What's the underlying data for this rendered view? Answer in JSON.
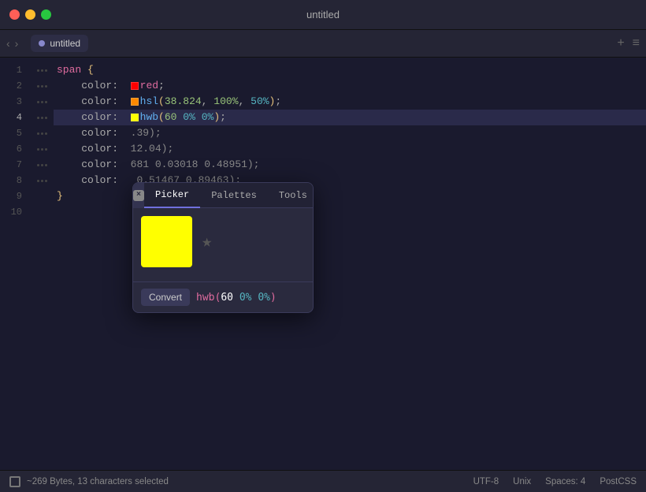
{
  "titlebar": {
    "title": "untitled",
    "dots": [
      "red",
      "yellow",
      "green"
    ]
  },
  "tabbar": {
    "tab_label": "untitled",
    "add_label": "+",
    "menu_label": "≡"
  },
  "editor": {
    "lines": [
      {
        "num": 1,
        "content": "span {"
      },
      {
        "num": 2,
        "content": "    color:  red;"
      },
      {
        "num": 3,
        "content": "    color:  hsl(38.824, 100%, 50%);"
      },
      {
        "num": 4,
        "content": "    color:  hwb(60 0% 0%);"
      },
      {
        "num": 5,
        "content": "    color:  .39);"
      },
      {
        "num": 6,
        "content": "    color:  12.04);"
      },
      {
        "num": 7,
        "content": "    color:  681 0.03018 0.48951);"
      },
      {
        "num": 8,
        "content": "    color:  0.51467 0.89463);"
      },
      {
        "num": 9,
        "content": "}"
      },
      {
        "num": 10,
        "content": ""
      }
    ]
  },
  "popup": {
    "close_label": "×",
    "tabs": [
      "Picker",
      "Palettes",
      "Tools"
    ],
    "active_tab": "Picker",
    "color_value": "#ffff00",
    "star_icon": "★",
    "convert_label": "Convert",
    "hwb_display": "hwb(60 0% 0%)",
    "hwb_parts": {
      "func": "hwb(",
      "n1": "60",
      "n2": "0%",
      "n3": "0%",
      "close": ")"
    }
  },
  "statusbar": {
    "bytes_info": "~269 Bytes, 13 characters selected",
    "encoding": "UTF-8",
    "line_ending": "Unix",
    "spaces": "Spaces: 4",
    "language": "PostCSS"
  }
}
